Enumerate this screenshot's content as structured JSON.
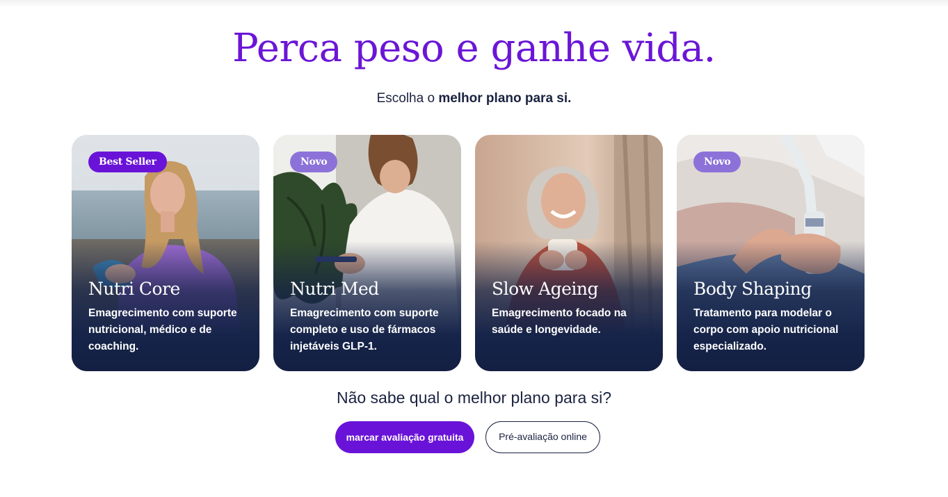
{
  "hero": {
    "title": "Perca peso e ganhe vida.",
    "subtitle_prefix": "Escolha o ",
    "subtitle_bold": "melhor plano para si."
  },
  "cards": [
    {
      "badge": "Best Seller",
      "title": "Nutri Core",
      "description": "Emagrecimento com suporte nutricional, médico e de coaching."
    },
    {
      "badge": "Novo",
      "title": "Nutri Med",
      "description": "Emagrecimento com suporte completo e uso de fármacos injetáveis GLP-1."
    },
    {
      "badge": "",
      "title": "Slow Ageing",
      "description": "Emagrecimento focado na saúde e longevidade."
    },
    {
      "badge": "Novo",
      "title": "Body Shaping",
      "description": "Tratamento para modelar o corpo com apoio nutricional especializado."
    }
  ],
  "cta": {
    "question": "Não sabe qual o melhor plano para si?",
    "primary_label": "marcar avaliação gratuita",
    "secondary_label": "Pré-avaliação online"
  },
  "colors": {
    "brand_purple": "#6a13d8",
    "badge_light_purple": "#8c72d8",
    "navy": "#1a2240",
    "card_overlay": "#16244a"
  }
}
